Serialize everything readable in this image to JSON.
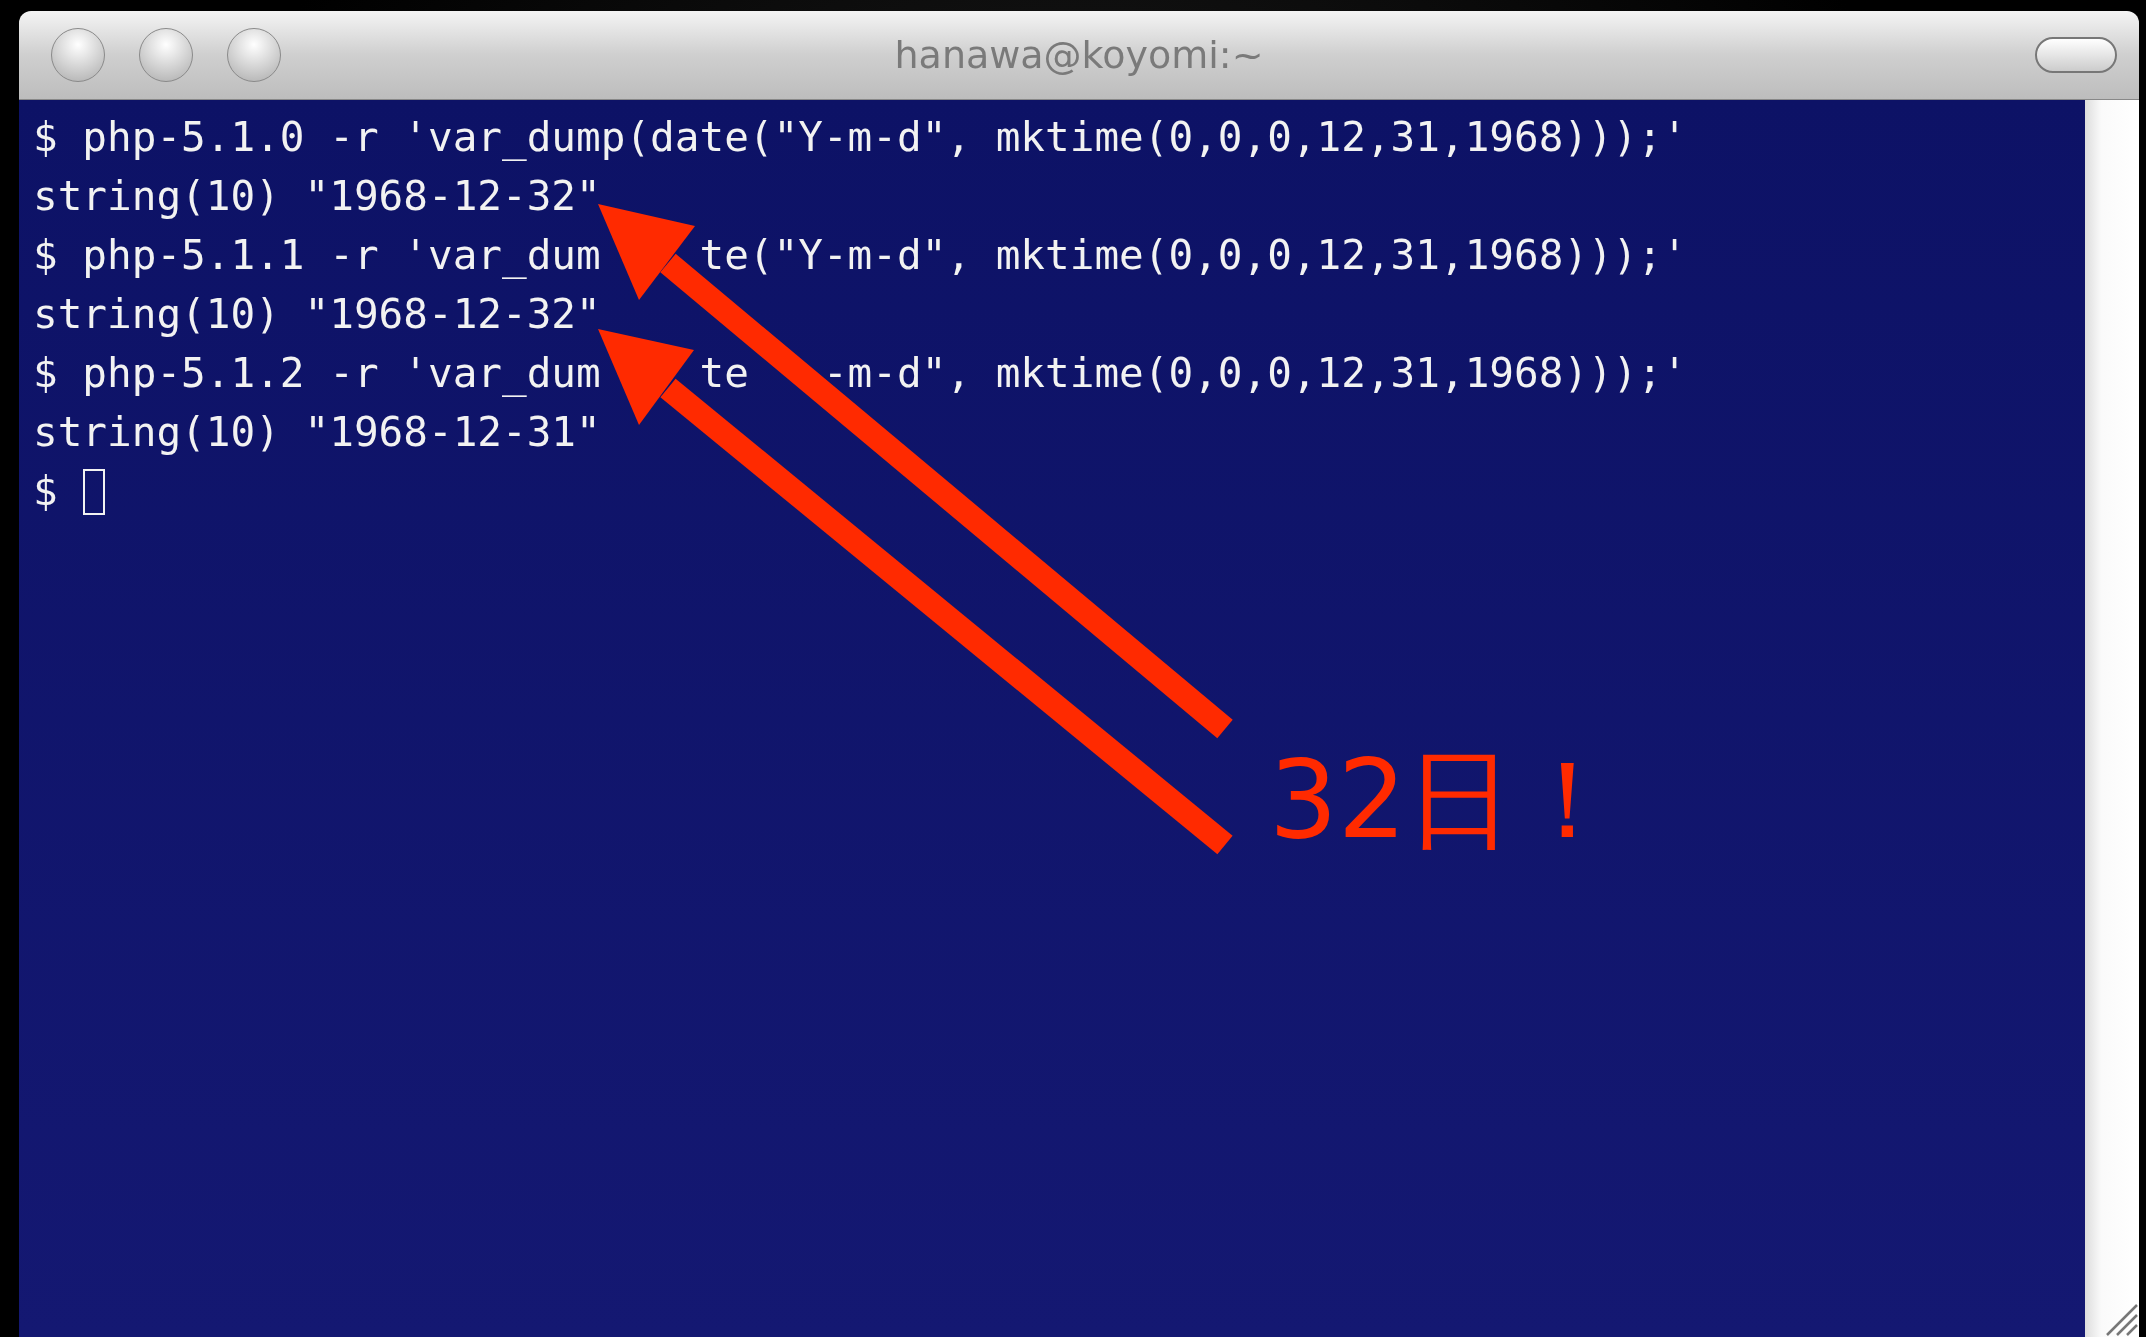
{
  "window": {
    "title": "hanawa@koyomi:~"
  },
  "terminal": {
    "lines": [
      {
        "segments": [
          "$ php-5.1.0 -r 'var_dump(date(\"Y-m-d\", mktime(0,0,0,12,31,1968)));'"
        ]
      },
      {
        "segments": [
          "string(10) \"1968-12-32\""
        ]
      },
      {
        "segments": [
          "$ php-5.1.1 -r 'var_dum",
          "te(\"Y-m-d\", mktime(0,0,0,12,31,1968)));'"
        ]
      },
      {
        "segments": [
          "string(10) \"1968-12-32\""
        ]
      },
      {
        "segments": [
          "$ php-5.1.2 -r 'var_dum",
          "te",
          "-m-d\", mktime(0,0,0,12,31,1968)));'"
        ]
      },
      {
        "segments": [
          "string(10) \"1968-12-31\""
        ]
      }
    ],
    "prompt": "$"
  },
  "annotation": {
    "text": "32日！"
  }
}
